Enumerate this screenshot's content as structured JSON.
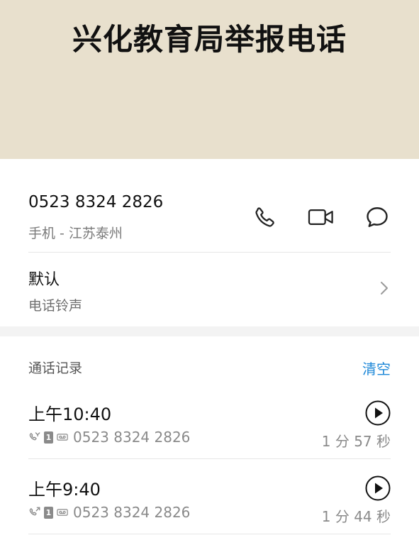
{
  "header": {
    "title": "兴化教育局举报电话"
  },
  "contact": {
    "number": "0523 8324 2826",
    "subtitle": "手机 - 江苏泰州",
    "actions": [
      {
        "icon": "phone-icon"
      },
      {
        "icon": "video-call-icon"
      },
      {
        "icon": "message-icon"
      }
    ]
  },
  "ringtone": {
    "title": "默认",
    "subtitle": "电话铃声"
  },
  "call_log": {
    "title": "通话记录",
    "clear_label": "清空",
    "entries": [
      {
        "time": "上午10:40",
        "sim": "1",
        "number": "0523 8324 2826",
        "duration": "1 分 57 秒",
        "call_icon": "missed-call-icon"
      },
      {
        "time": "上午9:40",
        "sim": "1",
        "number": "0523 8324 2826",
        "duration": "1 分 44 秒",
        "call_icon": "outgoing-call-icon"
      }
    ]
  },
  "colors": {
    "header_bg": "#e8e0cd",
    "accent": "#1e88d8"
  }
}
